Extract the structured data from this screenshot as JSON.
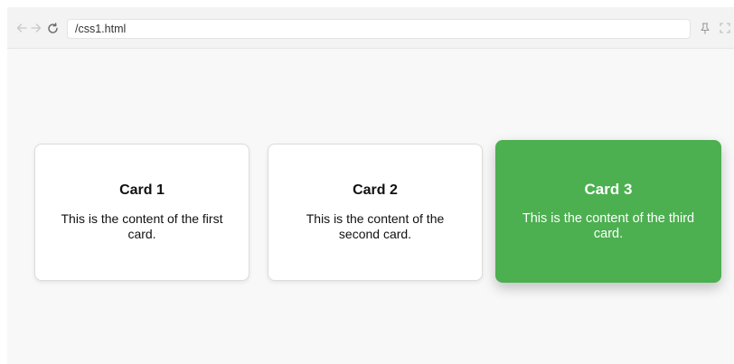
{
  "browser": {
    "url": "/css1.html"
  },
  "cards": [
    {
      "title": "Card 1",
      "content": "This is the content of the first card."
    },
    {
      "title": "Card 2",
      "content": "This is the content of the second card."
    },
    {
      "title": "Card 3",
      "content": "This is the content of the third card."
    }
  ],
  "colors": {
    "active_card": "#4caf50",
    "card_border": "#dcdcdc",
    "page_background": "#f8f8f8"
  },
  "icons": {
    "back": "arrow-left-icon",
    "forward": "arrow-right-icon",
    "reload": "reload-icon",
    "pin": "pin-icon",
    "fullscreen": "fullscreen-icon"
  }
}
